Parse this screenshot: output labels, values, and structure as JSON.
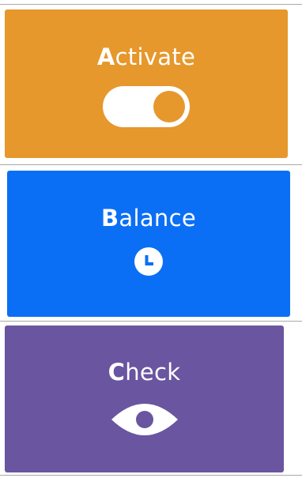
{
  "colors": {
    "activate": "#e6982c",
    "balance": "#0a6ff5",
    "check": "#6a55a0",
    "divider": "#a9a9a9",
    "text": "#ffffff"
  },
  "cards": [
    {
      "id": "activate",
      "label_initial": "A",
      "label_rest": "ctivate",
      "icon": "toggle-switch-on-icon",
      "toggle_on": true
    },
    {
      "id": "balance",
      "label_initial": "B",
      "label_rest": "alance",
      "icon": "clock-icon"
    },
    {
      "id": "check",
      "label_initial": "C",
      "label_rest": "heck",
      "icon": "eye-icon"
    }
  ]
}
